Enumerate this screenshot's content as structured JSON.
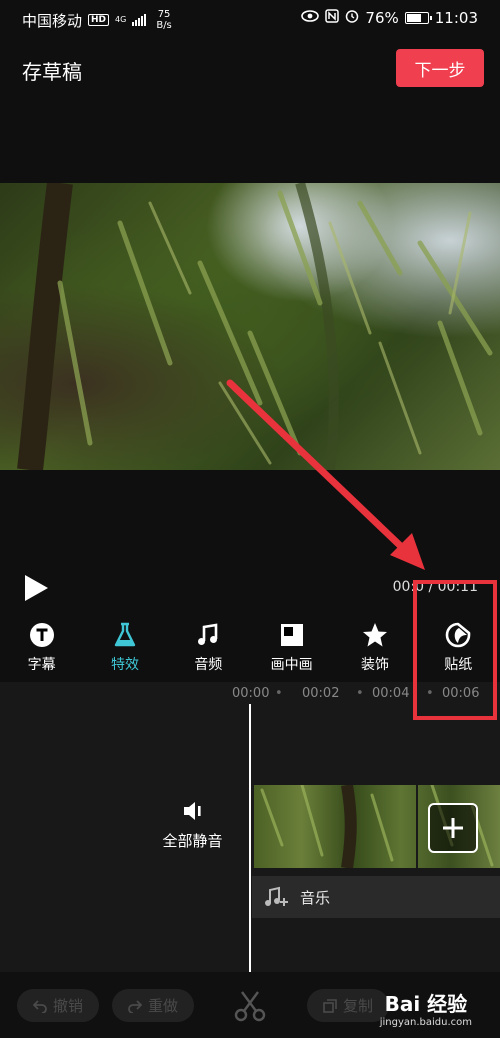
{
  "status_bar": {
    "carrier": "中国移动",
    "hd": "HD",
    "network": "4G",
    "speed_value": "75",
    "speed_unit": "B/s",
    "battery": "76%",
    "time": "11:03",
    "battery_level": 0.76
  },
  "top_bar": {
    "draft_label": "存草稿",
    "next_label": "下一步"
  },
  "playback": {
    "timecode": "00:0 / 00:11"
  },
  "tools": [
    {
      "label": "字幕",
      "icon": "subtitle-icon"
    },
    {
      "label": "特效",
      "icon": "effects-flask-icon",
      "active": true
    },
    {
      "label": "音频",
      "icon": "audio-note-icon"
    },
    {
      "label": "画中画",
      "icon": "picture-in-picture-icon"
    },
    {
      "label": "装饰",
      "icon": "decoration-star-icon"
    },
    {
      "label": "贴纸",
      "icon": "sticker-icon"
    }
  ],
  "timeline": {
    "ruler": [
      "00:00",
      "00:02",
      "00:04",
      "00:06"
    ],
    "mute_label": "全部静音",
    "music_label": "音乐"
  },
  "bottom_bar": {
    "undo_label": "撤销",
    "redo_label": "重做",
    "copy_label": "复制",
    "watermark_main": "Bai 经验",
    "watermark_sub": "jingyan.baidu.com"
  },
  "colors": {
    "accent_red": "#f04050",
    "active_cyan": "#3fc7d6",
    "annotation_red": "#e8323c"
  }
}
